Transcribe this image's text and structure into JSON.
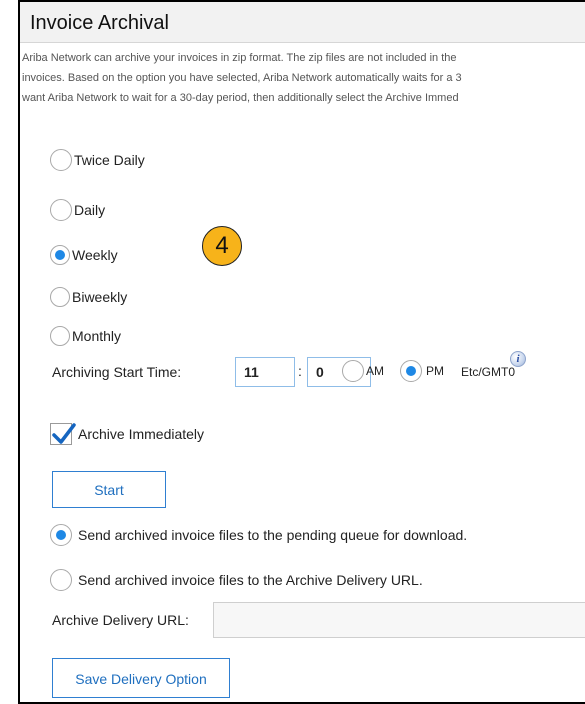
{
  "title": "Invoice Archival",
  "description": [
    "Ariba Network can archive your invoices in zip format. The zip files are not included in the",
    "invoices. Based on the option you have selected, Ariba Network automatically waits for a 3",
    "want Ariba Network to wait for a 30-day period, then additionally select the Archive Immed"
  ],
  "frequency": {
    "selected": "Weekly",
    "options": [
      "Twice Daily",
      "Daily",
      "Weekly",
      "Biweekly",
      "Monthly"
    ]
  },
  "badge": "4",
  "start_time": {
    "label": "Archiving Start Time:",
    "hour": "11",
    "separator": ":",
    "minute": "0",
    "am_label": "AM",
    "pm_label": "PM",
    "selected": "PM",
    "timezone": "Etc/GMT0",
    "info_icon": "info-icon"
  },
  "archive_immediately": {
    "label": "Archive Immediately",
    "checked": true
  },
  "start_button": "Start",
  "delivery": {
    "selected": "queue",
    "queue_label": "Send archived invoice files to the pending queue for download.",
    "url_option_label": "Send archived invoice files to the Archive Delivery URL.",
    "url_label": "Archive Delivery URL:",
    "url_value": ""
  },
  "save_button": "Save Delivery Option",
  "colors": {
    "accent": "#1e88e5",
    "badge": "#f7b31a",
    "button_text": "#1f6fbf"
  }
}
